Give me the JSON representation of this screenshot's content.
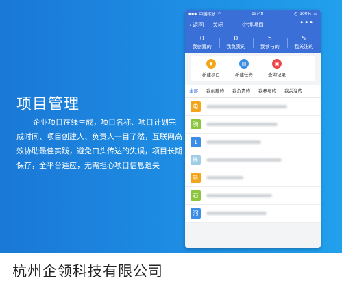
{
  "hero": {
    "heading": "项目管理",
    "description": "企业项目在线生成，项目名称、项目计划完成时间、项目创建人、负责人一目了然，互联网高效协助最佳实践，避免口头传达的失误，项目长期保存，全平台适应，无需担心项目信息遗失"
  },
  "footer": {
    "company": "杭州企领科技有限公司"
  },
  "phone": {
    "status": {
      "carrier": "中国移动",
      "time": "15:48",
      "battery": "100%"
    },
    "nav": {
      "back": "返回",
      "close": "关闭",
      "title": "企领项目",
      "more": "•••"
    },
    "stats": [
      {
        "num": "0",
        "label": "我创建的"
      },
      {
        "num": "0",
        "label": "我负责的"
      },
      {
        "num": "5",
        "label": "我参与的"
      },
      {
        "num": "5",
        "label": "我关注的"
      }
    ],
    "actions": [
      {
        "label": "新建项目",
        "color": "#f3a51a"
      },
      {
        "label": "新建任务",
        "color": "#3a8ee6"
      },
      {
        "label": "查询记录",
        "color": "#e9474a"
      }
    ],
    "tabs": [
      "全部",
      "我创建的",
      "我负责的",
      "我参与的",
      "我关注的"
    ],
    "rows": [
      {
        "char": "电",
        "color": "#f3a51a"
      },
      {
        "char": "骑",
        "color": "#8cc63f"
      },
      {
        "char": "1",
        "color": "#3a8ee6"
      },
      {
        "char": "雅",
        "color": "#9fcde6"
      },
      {
        "char": "新",
        "color": "#f3a51a"
      },
      {
        "char": "石",
        "color": "#8cc63f"
      },
      {
        "char": "河",
        "color": "#3a8ee6"
      }
    ]
  }
}
